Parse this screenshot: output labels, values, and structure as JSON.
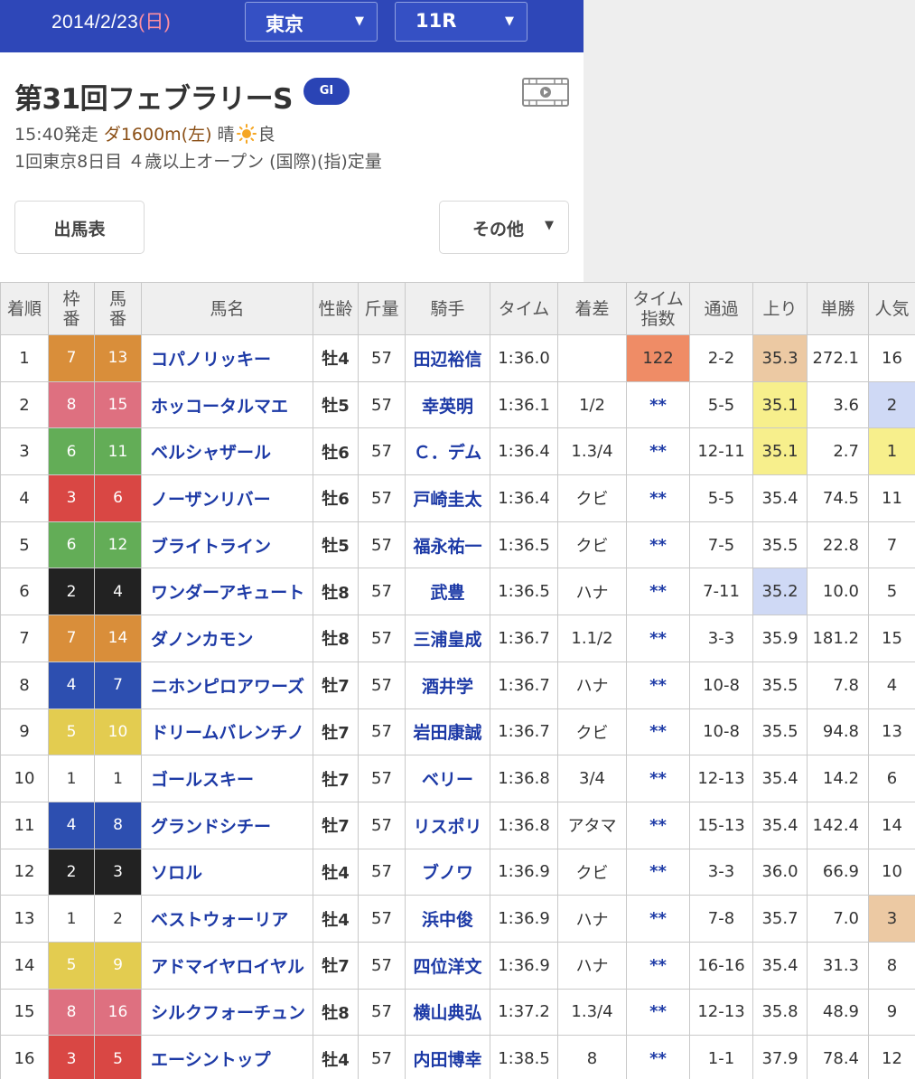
{
  "header": {
    "date": "2014/2/23",
    "dow": "(日)",
    "venue": "東京",
    "race_no": "11R"
  },
  "race": {
    "title": "第31回フェブラリーS",
    "grade": "GI",
    "start": "15:40発走",
    "course": "ダ1600m(左)",
    "weather": "晴",
    "going": "良",
    "meeting": "1回東京8日目",
    "conditions": "４歳以上オープン (国際)(指)定量"
  },
  "buttons": {
    "entries": "出馬表",
    "other": "その他"
  },
  "icons": {
    "dropdown": "chevron-down-icon",
    "video": "video-icon",
    "weather": "sun-icon"
  },
  "colors": {
    "brand": "#2e47b8",
    "waku": {
      "1": "#ffffff",
      "2": "#222222",
      "3": "#d94744",
      "4": "#2d4fb0",
      "5": "#e3cc50",
      "6": "#63ad57",
      "7": "#d98e3a",
      "8": "#de7080"
    },
    "rank1": "#f7ef8c",
    "rank2": "#cfd9f5",
    "rank3": "#ecc9a3",
    "index_top": "#ef8c66"
  },
  "columns": [
    "着順",
    "枠番",
    "馬番",
    "馬名",
    "性齢",
    "斤量",
    "騎手",
    "タイム",
    "着差",
    "タイム指数",
    "通過",
    "上り",
    "単勝",
    "人気"
  ],
  "rows": [
    {
      "pos": "1",
      "waku": "7",
      "num": "13",
      "name": "コパノリッキー",
      "sex": "牡4",
      "wt": "57",
      "jockey": "田辺裕信",
      "time": "1:36.0",
      "margin": "",
      "idx": "122",
      "pass": "2-2",
      "last": "35.3",
      "odds": "272.1",
      "pop": "16",
      "last_rank": 3,
      "pop_rank": 0
    },
    {
      "pos": "2",
      "waku": "8",
      "num": "15",
      "name": "ホッコータルマエ",
      "sex": "牡5",
      "wt": "57",
      "jockey": "幸英明",
      "time": "1:36.1",
      "margin": "1/2",
      "idx": "**",
      "pass": "5-5",
      "last": "35.1",
      "odds": "3.6",
      "pop": "2",
      "last_rank": 1,
      "pop_rank": 2
    },
    {
      "pos": "3",
      "waku": "6",
      "num": "11",
      "name": "ベルシャザール",
      "sex": "牡6",
      "wt": "57",
      "jockey": "Ｃ．デム",
      "time": "1:36.4",
      "margin": "1.3/4",
      "idx": "**",
      "pass": "12-11",
      "last": "35.1",
      "odds": "2.7",
      "pop": "1",
      "last_rank": 1,
      "pop_rank": 1
    },
    {
      "pos": "4",
      "waku": "3",
      "num": "6",
      "name": "ノーザンリバー",
      "sex": "牡6",
      "wt": "57",
      "jockey": "戸崎圭太",
      "time": "1:36.4",
      "margin": "クビ",
      "idx": "**",
      "pass": "5-5",
      "last": "35.4",
      "odds": "74.5",
      "pop": "11",
      "last_rank": 0,
      "pop_rank": 0
    },
    {
      "pos": "5",
      "waku": "6",
      "num": "12",
      "name": "ブライトライン",
      "sex": "牡5",
      "wt": "57",
      "jockey": "福永祐一",
      "time": "1:36.5",
      "margin": "クビ",
      "idx": "**",
      "pass": "7-5",
      "last": "35.5",
      "odds": "22.8",
      "pop": "7",
      "last_rank": 0,
      "pop_rank": 0
    },
    {
      "pos": "6",
      "waku": "2",
      "num": "4",
      "name": "ワンダーアキュート",
      "sex": "牡8",
      "wt": "57",
      "jockey": "武豊",
      "time": "1:36.5",
      "margin": "ハナ",
      "idx": "**",
      "pass": "7-11",
      "last": "35.2",
      "odds": "10.0",
      "pop": "5",
      "last_rank": 2,
      "pop_rank": 0
    },
    {
      "pos": "7",
      "waku": "7",
      "num": "14",
      "name": "ダノンカモン",
      "sex": "牡8",
      "wt": "57",
      "jockey": "三浦皇成",
      "time": "1:36.7",
      "margin": "1.1/2",
      "idx": "**",
      "pass": "3-3",
      "last": "35.9",
      "odds": "181.2",
      "pop": "15",
      "last_rank": 0,
      "pop_rank": 0
    },
    {
      "pos": "8",
      "waku": "4",
      "num": "7",
      "name": "ニホンピロアワーズ",
      "sex": "牡7",
      "wt": "57",
      "jockey": "酒井学",
      "time": "1:36.7",
      "margin": "ハナ",
      "idx": "**",
      "pass": "10-8",
      "last": "35.5",
      "odds": "7.8",
      "pop": "4",
      "last_rank": 0,
      "pop_rank": 0
    },
    {
      "pos": "9",
      "waku": "5",
      "num": "10",
      "name": "ドリームバレンチノ",
      "sex": "牡7",
      "wt": "57",
      "jockey": "岩田康誠",
      "time": "1:36.7",
      "margin": "クビ",
      "idx": "**",
      "pass": "10-8",
      "last": "35.5",
      "odds": "94.8",
      "pop": "13",
      "last_rank": 0,
      "pop_rank": 0
    },
    {
      "pos": "10",
      "waku": "1",
      "num": "1",
      "name": "ゴールスキー",
      "sex": "牡7",
      "wt": "57",
      "jockey": "ベリー",
      "time": "1:36.8",
      "margin": "3/4",
      "idx": "**",
      "pass": "12-13",
      "last": "35.4",
      "odds": "14.2",
      "pop": "6",
      "last_rank": 0,
      "pop_rank": 0
    },
    {
      "pos": "11",
      "waku": "4",
      "num": "8",
      "name": "グランドシチー",
      "sex": "牡7",
      "wt": "57",
      "jockey": "リスポリ",
      "time": "1:36.8",
      "margin": "アタマ",
      "idx": "**",
      "pass": "15-13",
      "last": "35.4",
      "odds": "142.4",
      "pop": "14",
      "last_rank": 0,
      "pop_rank": 0
    },
    {
      "pos": "12",
      "waku": "2",
      "num": "3",
      "name": "ソロル",
      "sex": "牡4",
      "wt": "57",
      "jockey": "ブノワ",
      "time": "1:36.9",
      "margin": "クビ",
      "idx": "**",
      "pass": "3-3",
      "last": "36.0",
      "odds": "66.9",
      "pop": "10",
      "last_rank": 0,
      "pop_rank": 0
    },
    {
      "pos": "13",
      "waku": "1",
      "num": "2",
      "name": "ベストウォーリア",
      "sex": "牡4",
      "wt": "57",
      "jockey": "浜中俊",
      "time": "1:36.9",
      "margin": "ハナ",
      "idx": "**",
      "pass": "7-8",
      "last": "35.7",
      "odds": "7.0",
      "pop": "3",
      "last_rank": 0,
      "pop_rank": 3
    },
    {
      "pos": "14",
      "waku": "5",
      "num": "9",
      "name": "アドマイヤロイヤル",
      "sex": "牡7",
      "wt": "57",
      "jockey": "四位洋文",
      "time": "1:36.9",
      "margin": "ハナ",
      "idx": "**",
      "pass": "16-16",
      "last": "35.4",
      "odds": "31.3",
      "pop": "8",
      "last_rank": 0,
      "pop_rank": 0
    },
    {
      "pos": "15",
      "waku": "8",
      "num": "16",
      "name": "シルクフォーチュン",
      "sex": "牡8",
      "wt": "57",
      "jockey": "横山典弘",
      "time": "1:37.2",
      "margin": "1.3/4",
      "idx": "**",
      "pass": "12-13",
      "last": "35.8",
      "odds": "48.9",
      "pop": "9",
      "last_rank": 0,
      "pop_rank": 0
    },
    {
      "pos": "16",
      "waku": "3",
      "num": "5",
      "name": "エーシントップ",
      "sex": "牡4",
      "wt": "57",
      "jockey": "内田博幸",
      "time": "1:38.5",
      "margin": "8",
      "idx": "**",
      "pass": "1-1",
      "last": "37.9",
      "odds": "78.4",
      "pop": "12",
      "last_rank": 0,
      "pop_rank": 0
    }
  ]
}
